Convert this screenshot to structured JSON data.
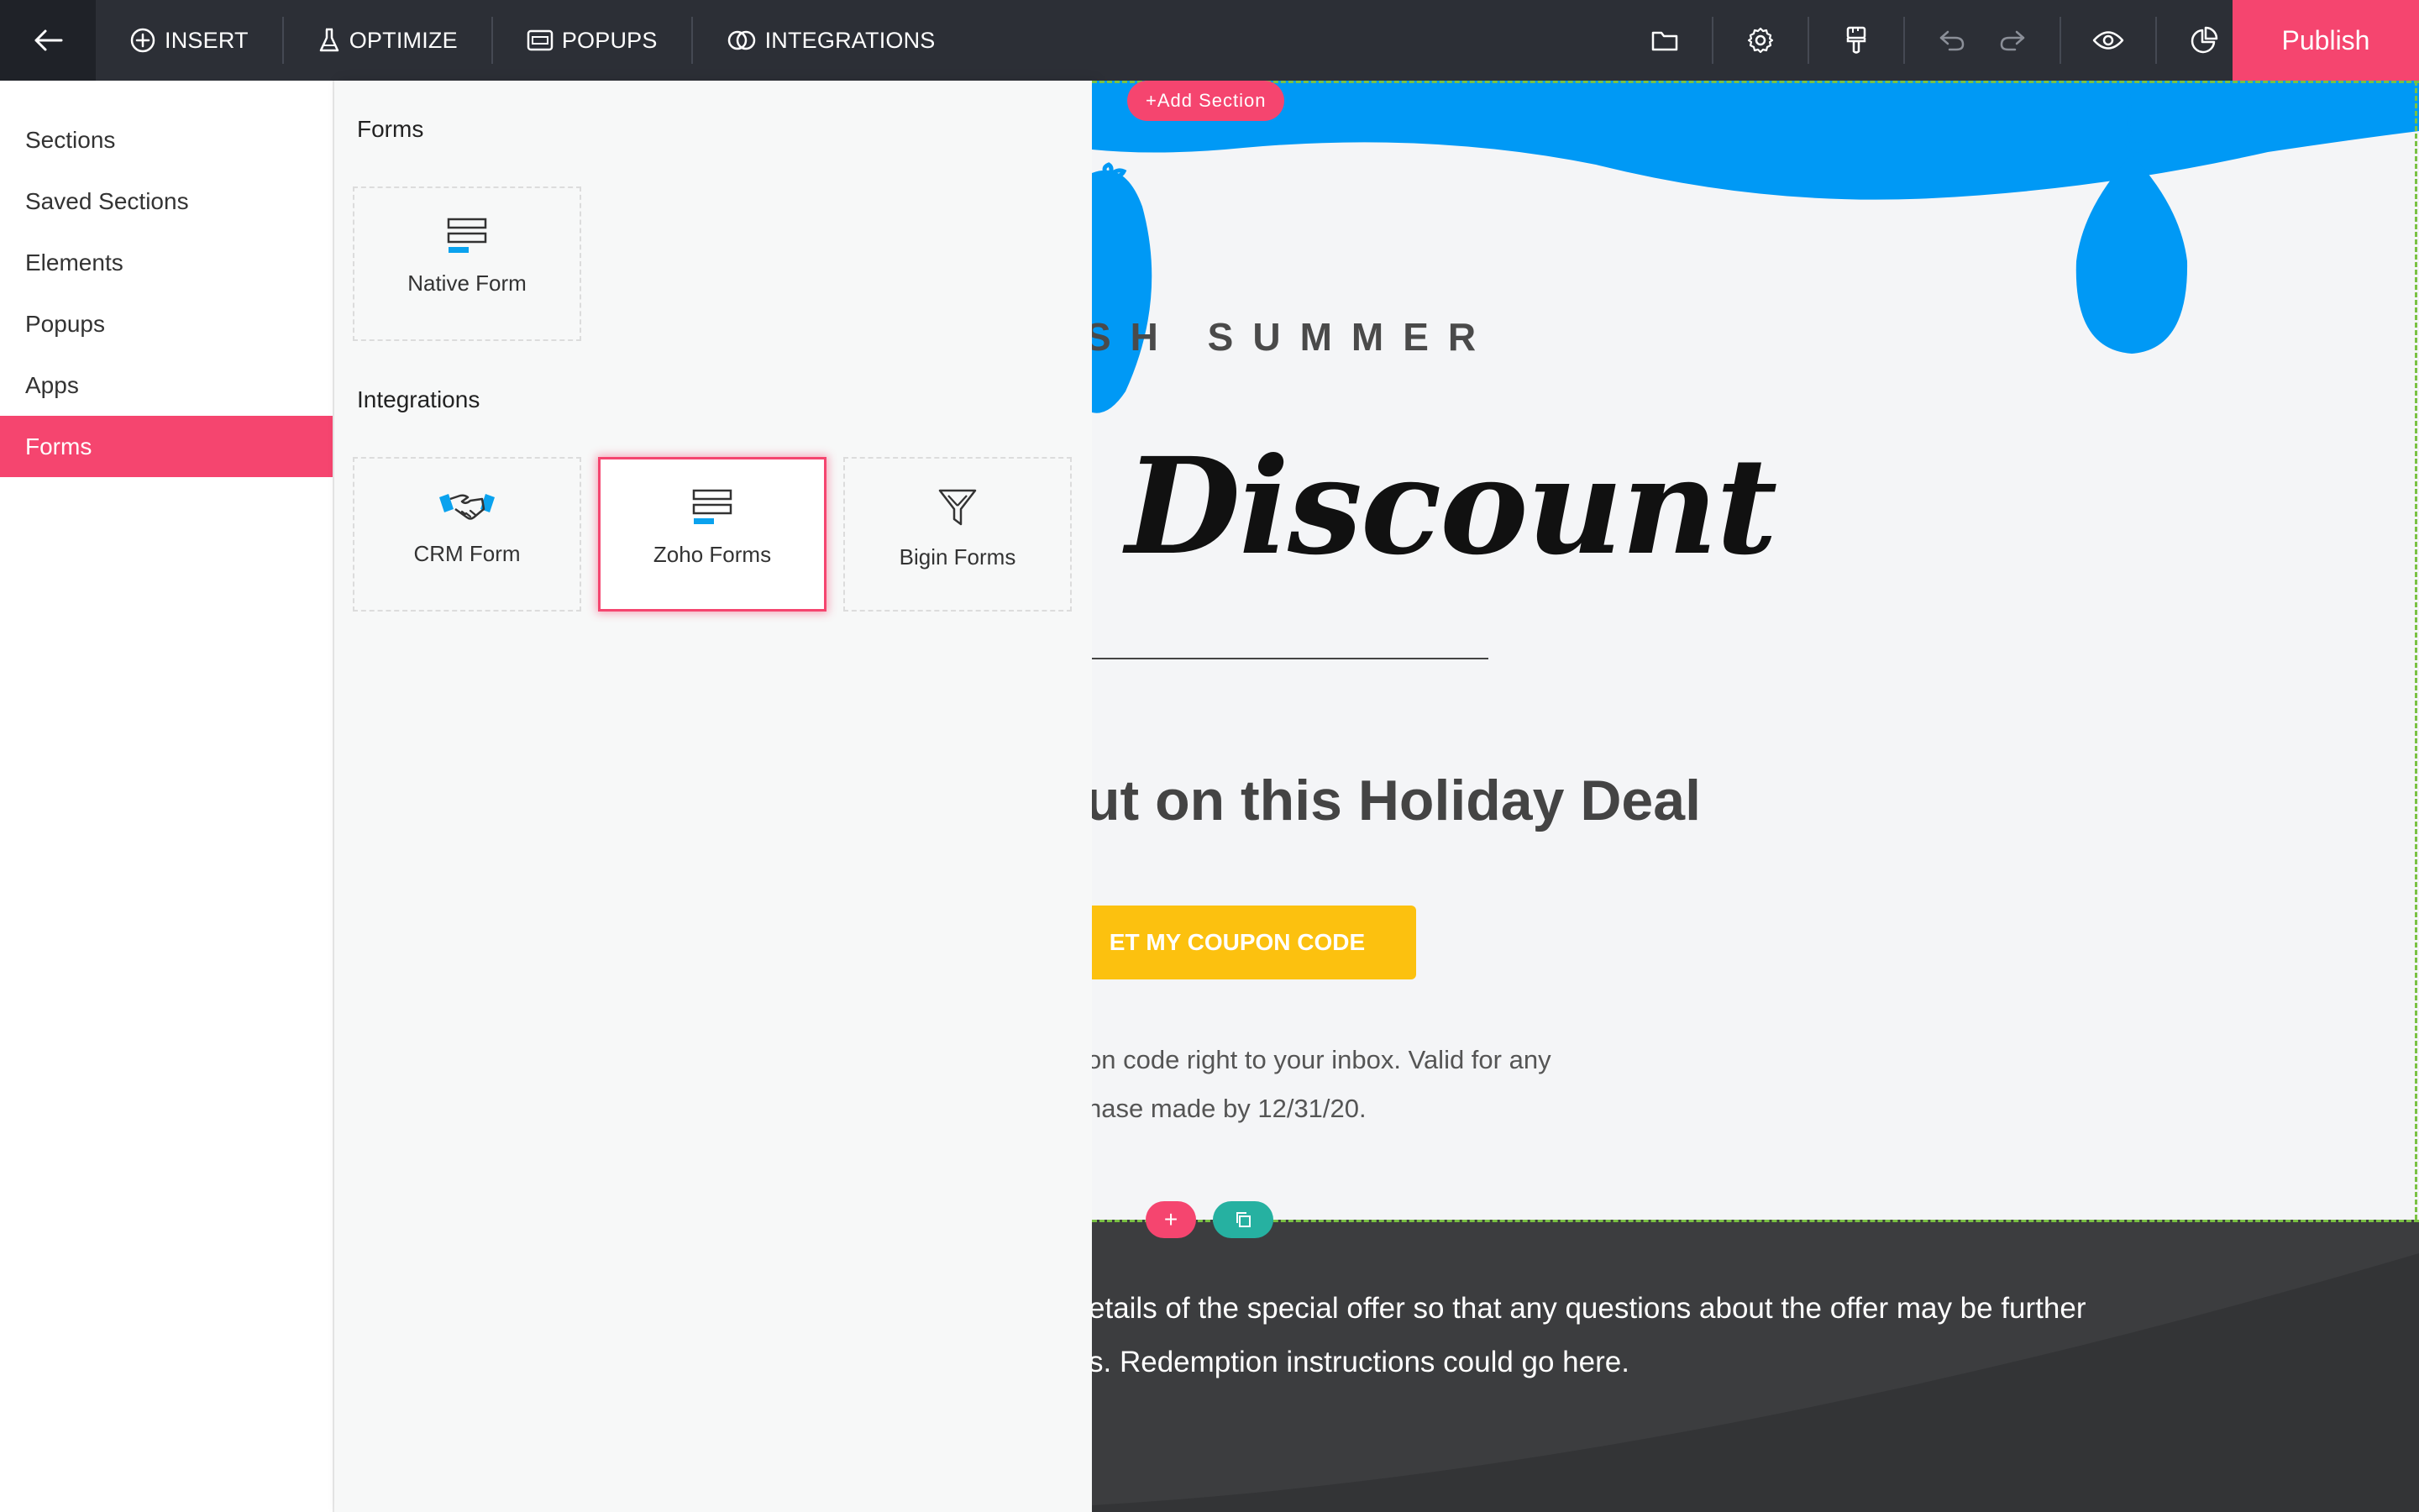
{
  "toolbar": {
    "nav": [
      {
        "label": "INSERT",
        "icon": "plus-circle-icon"
      },
      {
        "label": "OPTIMIZE",
        "icon": "flask-icon"
      },
      {
        "label": "POPUPS",
        "icon": "popup-window-icon"
      },
      {
        "label": "INTEGRATIONS",
        "icon": "link-rings-icon"
      }
    ],
    "tools": [
      "folder-icon",
      "settings-gear-icon",
      "paint-brush-icon",
      "undo-icon",
      "redo-icon",
      "preview-eye-icon",
      "analytics-pie-icon"
    ],
    "publish_label": "Publish"
  },
  "sidebar": {
    "items": [
      {
        "label": "Sections",
        "active": false
      },
      {
        "label": "Saved Sections",
        "active": false
      },
      {
        "label": "Elements",
        "active": false
      },
      {
        "label": "Popups",
        "active": false
      },
      {
        "label": "Apps",
        "active": false
      },
      {
        "label": "Forms",
        "active": true
      }
    ]
  },
  "panel": {
    "forms_heading": "Forms",
    "integrations_heading": "Integrations",
    "forms_cards": [
      {
        "label": "Native Form",
        "icon": "form-fields-icon"
      }
    ],
    "integration_cards": [
      {
        "label": "CRM Form",
        "icon": "handshake-icon"
      },
      {
        "label": "Zoho Forms",
        "icon": "form-fields-icon",
        "highlighted": true
      },
      {
        "label": "Bigin Forms",
        "icon": "funnel-icon"
      }
    ]
  },
  "canvas": {
    "add_section_label": "+Add Section",
    "kicker": "SH SUMMER",
    "title": "Discount",
    "headline": "ut on this Holiday Deal",
    "cta_label": "ET MY COUPON CODE",
    "body_lines": [
      "on code right to your inbox. Valid for any",
      "hase made by 12/31/20."
    ],
    "row_add_symbol": "+",
    "dark_lines": [
      "etails of the special offer so that any questions about the offer may be further",
      "s. Redemption instructions could go here."
    ]
  },
  "colors": {
    "accent_pink": "#f5456f",
    "topbar": "#2c2f36",
    "balloon_blue": "#0099f5",
    "cta_yellow": "#fcc10f",
    "dark_section": "#3c3d3f",
    "copy_teal": "#26b1a1",
    "outline_green": "#7ac143"
  }
}
